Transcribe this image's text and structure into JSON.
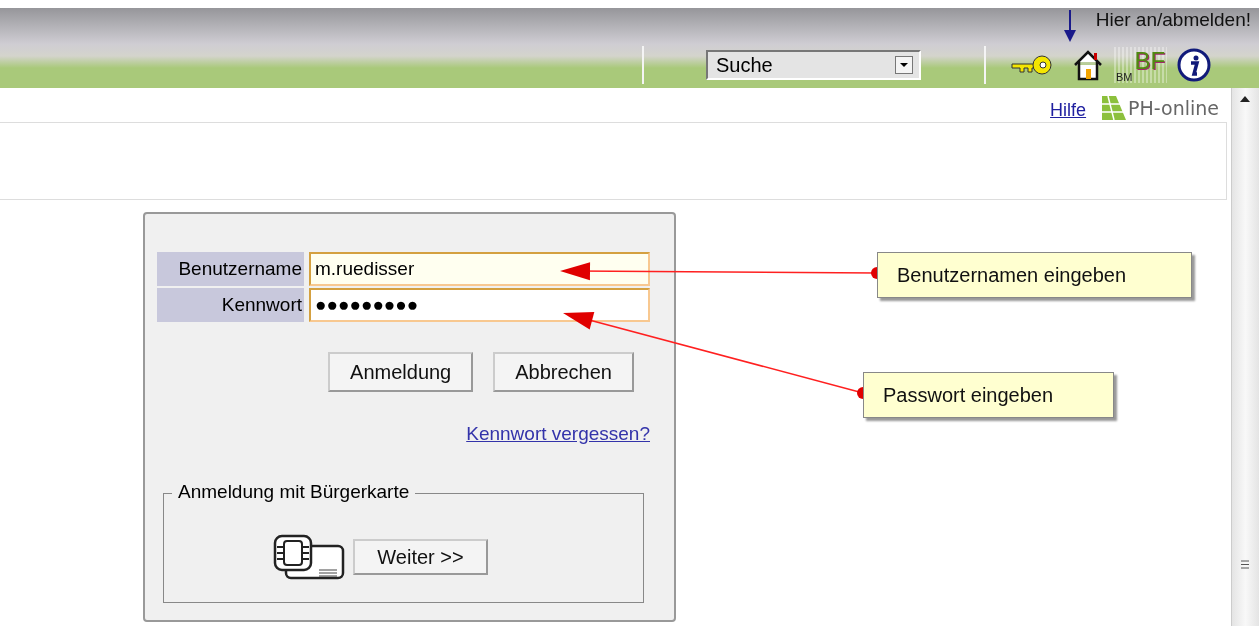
{
  "header": {
    "login_hint": "Hier an/abmelden!",
    "search_select": {
      "value": "Suche"
    },
    "bm_label": "BM",
    "bf_label": "BF"
  },
  "top_links": {
    "help": "Hilfe",
    "logo": "PH-online"
  },
  "login": {
    "fields": [
      {
        "label": "Benutzername",
        "value": "m.ruedisser",
        "focused": true
      },
      {
        "label": "Kennwort",
        "value": "●●●●●●●●●",
        "focused": false
      }
    ],
    "buttons": [
      "Anmeldung",
      "Abbrechen"
    ],
    "forgot_link": "Kennwort vergessen?",
    "citizen_card": {
      "legend": "Anmeldung mit Bürgerkarte",
      "button": "Weiter >>"
    }
  },
  "annotations": [
    {
      "text": "Benutzernamen eingeben"
    },
    {
      "text": "Passwort eingeben"
    }
  ]
}
